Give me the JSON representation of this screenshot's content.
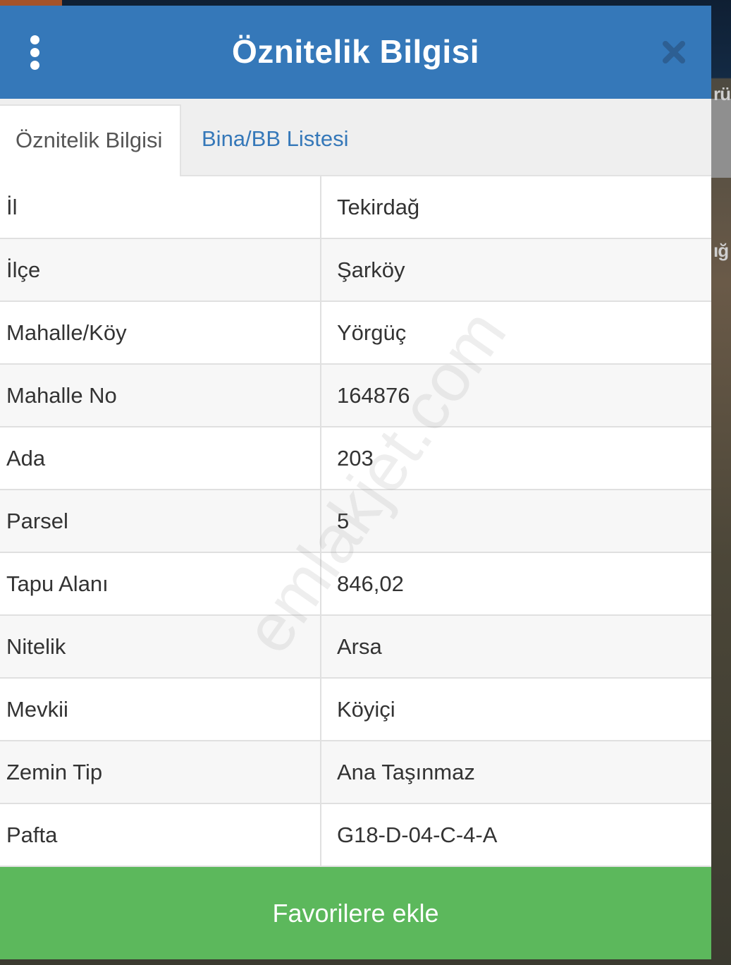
{
  "header": {
    "title": "Öznitelik Bilgisi",
    "menu_icon": "more-vertical-icon",
    "close_icon": "close-icon"
  },
  "tabs": [
    {
      "label": "Öznitelik Bilgisi",
      "active": true
    },
    {
      "label": "Bina/BB Listesi",
      "active": false
    }
  ],
  "rows": [
    {
      "key": "İl",
      "value": "Tekirdağ"
    },
    {
      "key": "İlçe",
      "value": "Şarköy"
    },
    {
      "key": "Mahalle/Köy",
      "value": "Yörgüç"
    },
    {
      "key": "Mahalle No",
      "value": "164876"
    },
    {
      "key": "Ada",
      "value": "203"
    },
    {
      "key": "Parsel",
      "value": "5"
    },
    {
      "key": "Tapu Alanı",
      "value": "846,02"
    },
    {
      "key": "Nitelik",
      "value": "Arsa"
    },
    {
      "key": "Mevkii",
      "value": "Köyiçi"
    },
    {
      "key": "Zemin Tip",
      "value": "Ana Taşınmaz"
    },
    {
      "key": "Pafta",
      "value": "G18-D-04-C-4-A"
    }
  ],
  "footer": {
    "favorite_label": "Favorilere ekle"
  },
  "watermark": "emlakjet.com",
  "colors": {
    "header": "#3578b9",
    "tab_active_text": "#555555",
    "tab_inactive_text": "#3578b9",
    "favorite_button": "#5cb85c"
  }
}
